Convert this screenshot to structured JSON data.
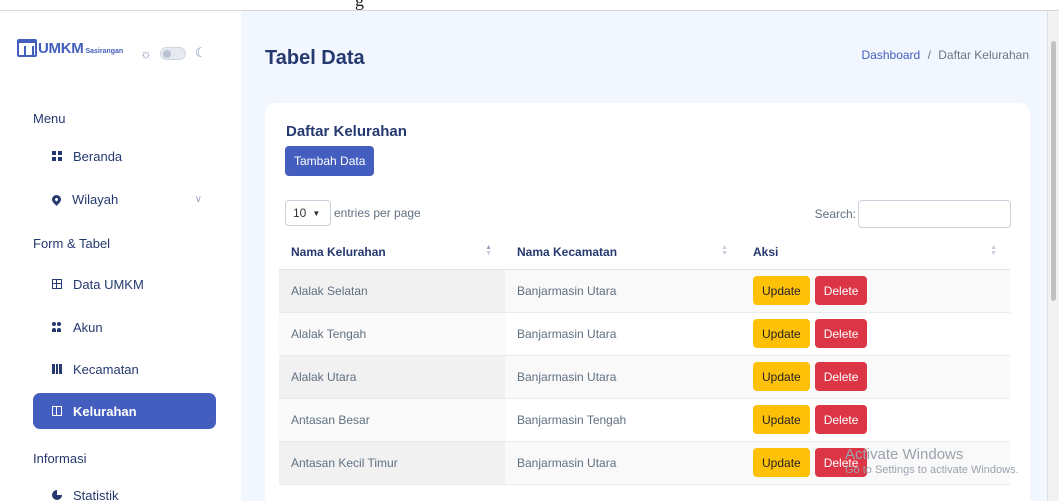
{
  "sidebar": {
    "logo": {
      "brand": "UMKM",
      "sub": "Sasirangan"
    },
    "theme_icons": {
      "sun": "☼",
      "moon": "☾"
    },
    "sections": {
      "menu": "Menu",
      "form_tabel": "Form & Tabel",
      "informasi": "Informasi"
    },
    "items": [
      {
        "label": "Beranda",
        "icon": "grid-icon"
      },
      {
        "label": "Wilayah",
        "icon": "map-pin-icon",
        "has_submenu": true
      },
      {
        "label": "Data UMKM",
        "icon": "table-icon"
      },
      {
        "label": "Akun",
        "icon": "people-icon"
      },
      {
        "label": "Kecamatan",
        "icon": "books-icon"
      },
      {
        "label": "Kelurahan",
        "icon": "columns-icon",
        "active": true
      },
      {
        "label": "Statistik",
        "icon": "pie-chart-icon"
      }
    ]
  },
  "header": {
    "title": "Tabel Data",
    "breadcrumb": {
      "home": "Dashboard",
      "separator": "/",
      "current": "Daftar Kelurahan"
    }
  },
  "card": {
    "title": "Daftar Kelurahan",
    "add_button": "Tambah Data",
    "entries": {
      "value": "10",
      "suffix": "entries per page"
    },
    "search_label": "Search:",
    "search_value": ""
  },
  "table": {
    "columns": [
      "Nama Kelurahan",
      "Nama Kecamatan",
      "Aksi"
    ],
    "rows": [
      {
        "kelurahan": "Alalak Selatan",
        "kecamatan": "Banjarmasin Utara"
      },
      {
        "kelurahan": "Alalak Tengah",
        "kecamatan": "Banjarmasin Utara"
      },
      {
        "kelurahan": "Alalak Utara",
        "kecamatan": "Banjarmasin Utara"
      },
      {
        "kelurahan": "Antasan Besar",
        "kecamatan": "Banjarmasin Tengah"
      },
      {
        "kelurahan": "Antasan Kecil Timur",
        "kecamatan": "Banjarmasin Utara"
      }
    ],
    "actions": {
      "update": "Update",
      "delete": "Delete"
    }
  },
  "watermark": {
    "line1": "Activate Windows",
    "line2": "Go to Settings to activate Windows."
  },
  "colors": {
    "primary": "#435ebe",
    "warning": "#ffc107",
    "danger": "#dc3545",
    "background": "#f2f7ff"
  }
}
